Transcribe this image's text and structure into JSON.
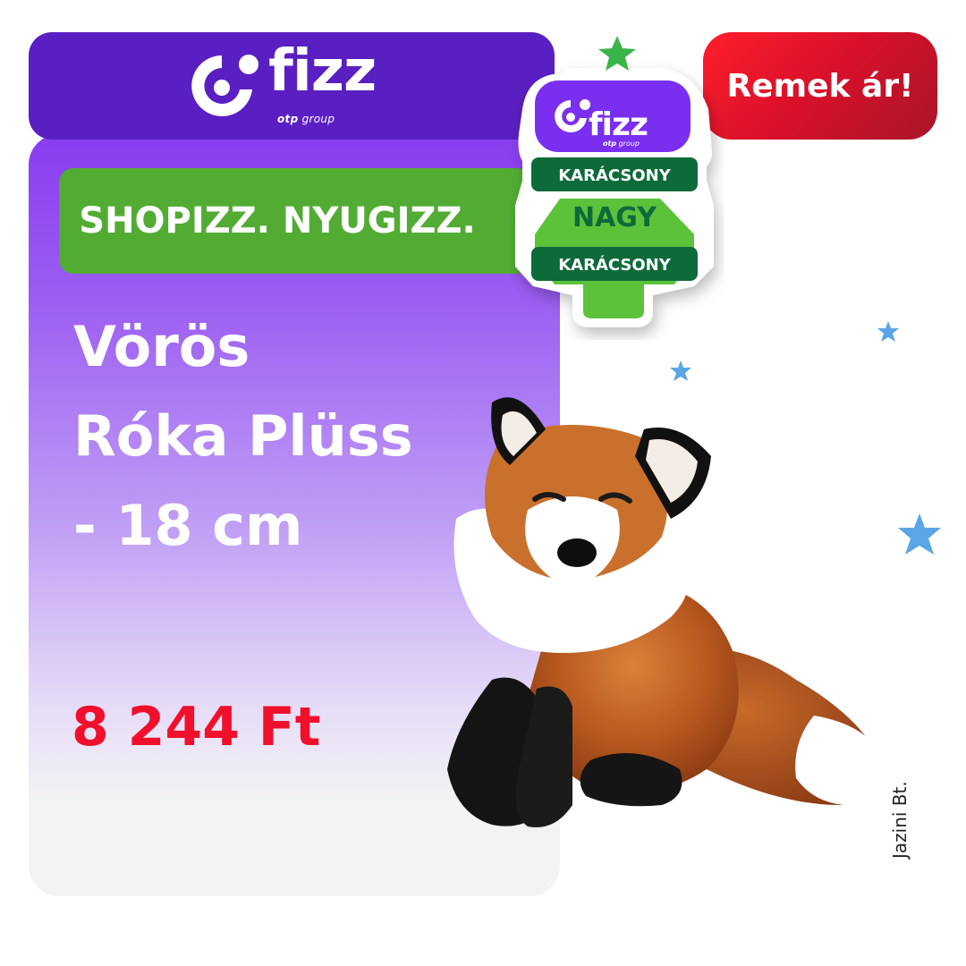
{
  "brand": {
    "logo_text": "fizz",
    "logo_sub_strong": "otp",
    "logo_sub": " group"
  },
  "slogan": "SHOPIZZ. NYUGIZZ.",
  "product": {
    "title_lines": [
      "Vörös",
      "Róka Plüss",
      "- 18 cm"
    ],
    "price": "8 244 Ft"
  },
  "deal_badge": "Remek ár!",
  "sticker": {
    "logo_text": "fizz",
    "logo_sub_strong": "otp",
    "logo_sub": " group",
    "line1": "KARÁCSONY",
    "line2": "NAGY",
    "line3": "KARÁCSONY"
  },
  "credit": "Jazini Bt.",
  "colors": {
    "brand_purple": "#5a1fc2",
    "slogan_green": "#52ac34",
    "price_red": "#f0102c",
    "badge_red": "#d8102a",
    "sticker_dark_green": "#0d6b3a",
    "sticker_light_green": "#5cc23a",
    "star_blue": "#5aa5e6"
  },
  "icons": [
    "fizz-logo-icon",
    "christmas-tree-sticker-icon",
    "star-icon",
    "fox-plush-image"
  ]
}
